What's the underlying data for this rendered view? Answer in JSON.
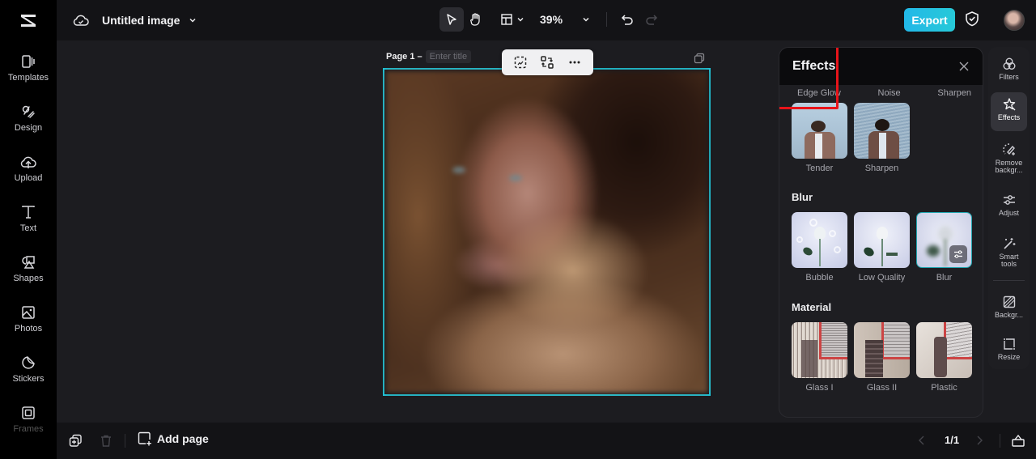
{
  "header": {
    "doc_title": "Untitled image",
    "zoom": "39%",
    "export_label": "Export",
    "colors": {
      "accent": "#22b8e8",
      "selection": "#1fc4d8",
      "highlight": "#e8141a"
    }
  },
  "sidebar": {
    "items": [
      {
        "label": "Templates",
        "icon": "templates-icon"
      },
      {
        "label": "Design",
        "icon": "design-icon"
      },
      {
        "label": "Upload",
        "icon": "upload-icon"
      },
      {
        "label": "Text",
        "icon": "text-icon"
      },
      {
        "label": "Shapes",
        "icon": "shapes-icon"
      },
      {
        "label": "Photos",
        "icon": "photos-icon"
      },
      {
        "label": "Stickers",
        "icon": "stickers-icon"
      },
      {
        "label": "Frames",
        "icon": "frames-icon"
      }
    ]
  },
  "canvas": {
    "page_label": "Page 1 –",
    "title_placeholder": "Enter title"
  },
  "effects_panel": {
    "title": "Effects",
    "top_row_labels": [
      "Edge Glow",
      "Noise",
      "Sharpen"
    ],
    "sections": [
      {
        "title": "",
        "items": [
          {
            "label": "Tender"
          },
          {
            "label": "Sharpen"
          }
        ]
      },
      {
        "title": "Blur",
        "items": [
          {
            "label": "Bubble"
          },
          {
            "label": "Low Quality"
          },
          {
            "label": "Blur",
            "selected": true
          }
        ]
      },
      {
        "title": "Material",
        "items": [
          {
            "label": "Glass I"
          },
          {
            "label": "Glass II"
          },
          {
            "label": "Plastic"
          }
        ]
      }
    ]
  },
  "right_toolbar": {
    "items": [
      {
        "label": "Filters"
      },
      {
        "label": "Effects",
        "active": true
      },
      {
        "label": "Remove backgr..."
      },
      {
        "label": "Adjust"
      },
      {
        "label": "Smart tools"
      },
      {
        "label": "Backgr..."
      },
      {
        "label": "Resize"
      }
    ]
  },
  "bottom": {
    "add_page_label": "Add page",
    "page_indicator": "1/1"
  }
}
